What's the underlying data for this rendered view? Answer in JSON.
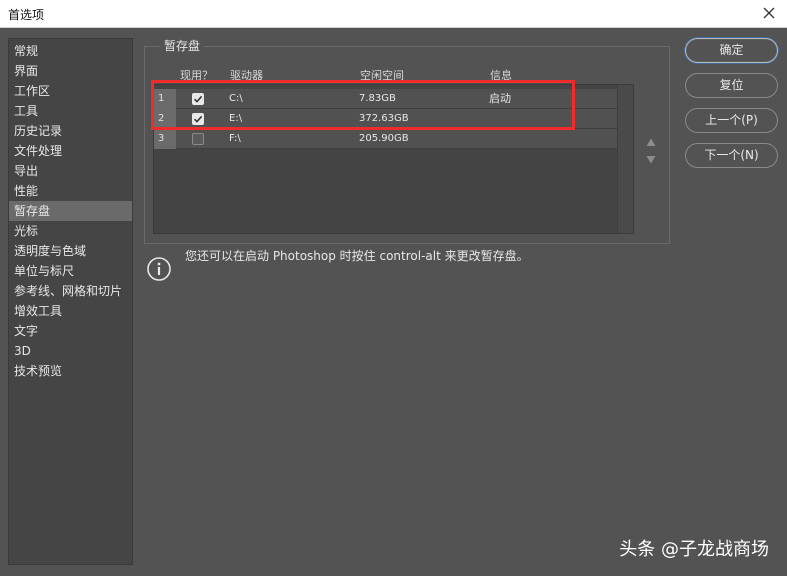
{
  "window": {
    "title": "首选项"
  },
  "sidebar": {
    "items": [
      {
        "label": "常规"
      },
      {
        "label": "界面"
      },
      {
        "label": "工作区"
      },
      {
        "label": "工具"
      },
      {
        "label": "历史记录"
      },
      {
        "label": "文件处理"
      },
      {
        "label": "导出"
      },
      {
        "label": "性能"
      },
      {
        "label": "暂存盘"
      },
      {
        "label": "光标"
      },
      {
        "label": "透明度与色域"
      },
      {
        "label": "单位与标尺"
      },
      {
        "label": "参考线、网格和切片"
      },
      {
        "label": "增效工具"
      },
      {
        "label": "文字"
      },
      {
        "label": "3D"
      },
      {
        "label": "技术预览"
      }
    ],
    "active_index": 8
  },
  "scratch": {
    "group_title": "暂存盘",
    "columns": [
      "现用？",
      "驱动器",
      "空闲空间",
      "信息"
    ],
    "rows": [
      {
        "num": "1",
        "active": true,
        "drive": "C:\\",
        "free": "7.83GB",
        "info": "启动"
      },
      {
        "num": "2",
        "active": true,
        "drive": "E:\\",
        "free": "372.63GB",
        "info": ""
      },
      {
        "num": "3",
        "active": false,
        "drive": "F:\\",
        "free": "205.90GB",
        "info": ""
      }
    ],
    "hint": "您还可以在启动 Photoshop 时按住 control-alt 来更改暂存盘。"
  },
  "buttons": {
    "ok": "确定",
    "reset": "复位",
    "prev": "上一个(P)",
    "next": "下一个(N)"
  },
  "watermark": "头条 @子龙战商场",
  "colors": {
    "highlight": "#ef2b2b",
    "background": "#535353"
  }
}
